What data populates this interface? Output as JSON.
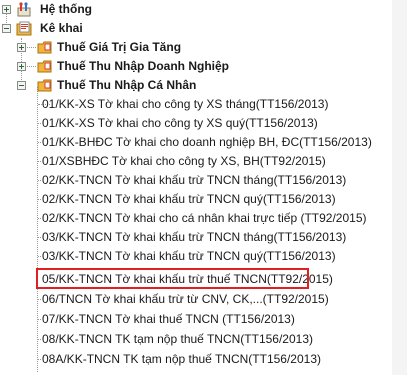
{
  "tree": {
    "root1": {
      "label": "Hệ thống",
      "icon": "settings-tools-icon"
    },
    "root2": {
      "label": "Kê khai",
      "icon": "folder-form-icon"
    },
    "groups": [
      {
        "label": "Thuế Giá Trị Gia Tăng",
        "icon": "folder-icon"
      },
      {
        "label": "Thuế Thu Nhập Doanh Nghiệp",
        "icon": "folder-icon"
      },
      {
        "label": "Thuế Thu Nhập Cá Nhân",
        "icon": "folder-open-icon"
      }
    ],
    "items": [
      "01/KK-XS Tờ khai cho công ty XS tháng(TT156/2013)",
      "01/KK-XS Tờ khai cho công ty XS quý(TT156/2013)",
      "01/KK-BHĐC Tờ khai cho doanh nghiệp BH, ĐC(TT156/2013)",
      "01/XSBHĐC Tờ khai cho công ty XS, BH(TT92/2015)",
      "02/KK-TNCN Tờ khai khấu trừ TNCN tháng(TT156/2013)",
      "02/KK-TNCN Tờ khai khấu trừ TNCN quý(TT156/2013)",
      "02/KK-TNCN Tờ khai cho cá nhân khai trực tiếp (TT92/2015)",
      "03/KK-TNCN Tờ khai khấu trừ TNCN tháng(TT156/2013)",
      "03/KK-TNCN Tờ khai khấu trừ TNCN quý(TT156/2013)",
      "05/KK-TNCN Tờ khai khấu trừ thuế TNCN(TT92/2015)",
      "06/TNCN Tờ khai khấu trừ từ CNV, CK,...(TT92/2015)",
      "07/KK-TNCN Tờ khai thuế TNCN (TT156/2013)",
      "08/KK-TNCN TK tạm nộp thuế TNCN(TT156/2013)",
      "08A/KK-TNCN TK tạm nộp thuế TNCN(TT156/2013)"
    ],
    "highlighted_item_index": 9
  },
  "colors": {
    "highlight_border": "#e02020",
    "folder": "#f2b53b",
    "form_red": "#d83a2a"
  }
}
